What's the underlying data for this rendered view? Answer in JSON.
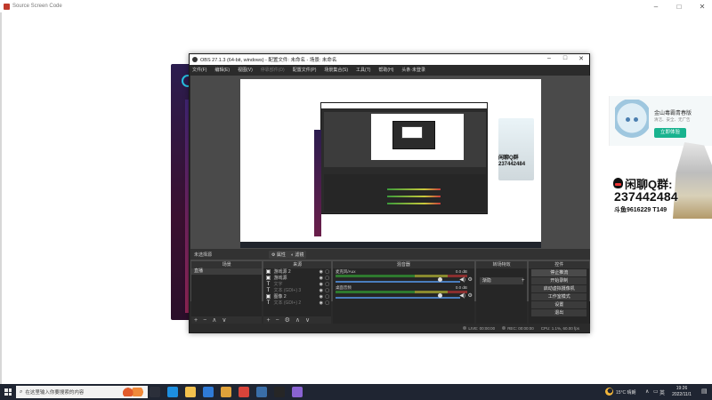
{
  "host_window": {
    "title": "Source Screen Code"
  },
  "obs": {
    "title": "OBS 27.1.3 (64-bit, windows) - 配置文件: 未命名 - 场景: 未命名",
    "menu": [
      "文件(F)",
      "编辑(E)",
      "视图(V)",
      "停靠部件(D)",
      "配置文件(P)",
      "场景集合(S)",
      "工具(T)",
      "帮助(H)",
      "头条·未登录"
    ],
    "menu_dim_index": 3,
    "scene_bar": {
      "label": "未选择源",
      "properties": "属性",
      "filters": "滤镜"
    },
    "docks": {
      "scenes": {
        "header": "场景",
        "items": [
          "直播"
        ]
      },
      "sources": {
        "header": "来源",
        "items": [
          {
            "icon": "image-icon",
            "glyph": "▣",
            "label": "游戏源 2",
            "dim": false
          },
          {
            "icon": "image-icon",
            "glyph": "▣",
            "label": "游戏源",
            "dim": false
          },
          {
            "icon": "text-icon",
            "glyph": "T",
            "label": "文字",
            "dim": true
          },
          {
            "icon": "text-icon",
            "glyph": "T",
            "label": "文本 (GDI+) 3",
            "dim": true
          },
          {
            "icon": "image-icon",
            "glyph": "▣",
            "label": "图像 2",
            "dim": false
          },
          {
            "icon": "text-icon",
            "glyph": "T",
            "label": "文本 (GDI+) 2",
            "dim": true
          }
        ]
      },
      "mixer": {
        "header": "混音器",
        "channels": [
          {
            "name": "麦克风/Aux",
            "db": "0.0 dB"
          },
          {
            "name": "桌面音频",
            "db": "0.0 dB"
          }
        ]
      },
      "transitions": {
        "header": "转场特效",
        "selected": "渐隐",
        "add": "+"
      },
      "controls": {
        "header": "控件",
        "buttons": [
          "停止推流",
          "开始录制",
          "启动虚拟摄像机",
          "工作室模式",
          "设置",
          "退出"
        ],
        "active_index": 0
      }
    },
    "status": {
      "live": "LIVE: 00:00:00",
      "rec": "REC: 00:00:00",
      "cpu": "CPU: 1.1%, 60.00 fps"
    }
  },
  "ad": {
    "title": "金山毒霸青春版",
    "subtitle": "清洁、安全、无广告",
    "button": "立即体验"
  },
  "overlay": {
    "qq_label": "闲聊Q群:",
    "qq_number": "237442484",
    "sub": "斗鱼9616229 T149"
  },
  "nested": {
    "qq_label": "闲聊Q群",
    "qq_number": "237442484"
  },
  "taskbar": {
    "search_placeholder": "在这里输入你要搜索的内容",
    "weather": "15°C 晴朗",
    "ime": "英",
    "time": "19:26",
    "date": "2022/11/1",
    "app_icons": [
      {
        "name": "task-view-icon",
        "color": "#2b2f3a"
      },
      {
        "name": "edge-icon",
        "color": "#1d8fe0"
      },
      {
        "name": "file-explorer-icon",
        "color": "#f2c14e"
      },
      {
        "name": "store-icon",
        "color": "#2f7bd8"
      },
      {
        "name": "game-icon",
        "color": "#e0a23a"
      },
      {
        "name": "chrome-icon",
        "color": "#d8443a"
      },
      {
        "name": "steam-icon",
        "color": "#3a6ea8"
      },
      {
        "name": "obs-icon",
        "color": "#262626"
      },
      {
        "name": "app-icon",
        "color": "#8a63d2"
      }
    ],
    "accent": "#1f2532"
  },
  "colors": {
    "obs_bg": "#2b2b2b",
    "dock_bg": "#262626",
    "preview_bg": "#4a4a4a",
    "ad_button": "#19b38f"
  }
}
